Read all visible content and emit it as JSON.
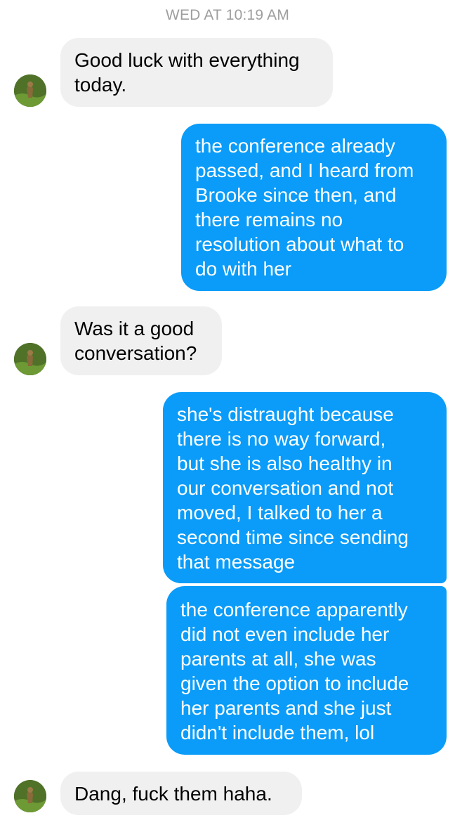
{
  "thread": {
    "timestamp": "WED AT 10:19 AM",
    "messages": [
      {
        "direction": "incoming",
        "text": "Good luck with everything\ntoday."
      },
      {
        "direction": "outgoing",
        "text": "the conference already\npassed, and I heard from\nBrooke since then, and\nthere remains no\nresolution about what to\ndo with her"
      },
      {
        "direction": "incoming",
        "text": "Was it a good\nconversation?"
      },
      {
        "direction": "outgoing",
        "text": "she's distraught because\nthere is no way forward,\nbut she is also healthy in\nour conversation and not\nmoved, I talked to her a\nsecond time since sending\nthat message"
      },
      {
        "direction": "outgoing",
        "text": "the conference apparently\ndid not even include her\nparents at all, she was\ngiven the option to include\nher parents and she just\ndidn't include them, lol"
      },
      {
        "direction": "incoming",
        "text": "Dang, fuck them haha."
      }
    ]
  },
  "colors": {
    "incoming_bubble": "#f1f0f0",
    "outgoing_bubble": "#0a9cf8",
    "timestamp": "#9e9e9e"
  },
  "icons": {
    "avatar": "contact-avatar-photo"
  }
}
